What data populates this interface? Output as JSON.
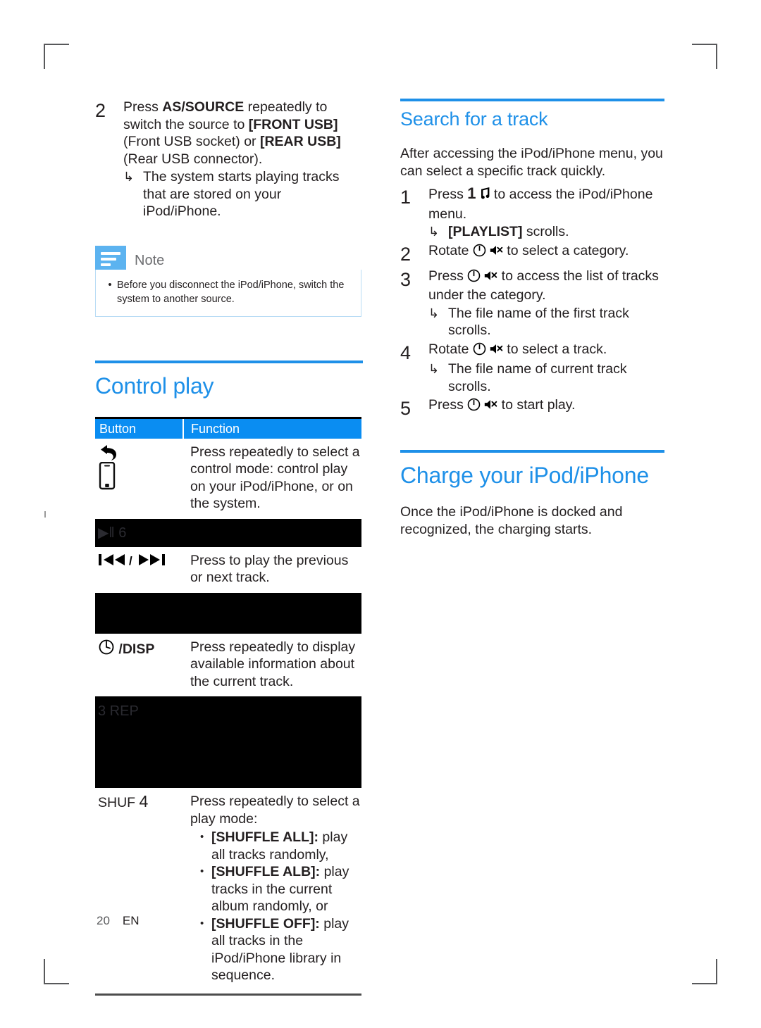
{
  "colors": {
    "brand_blue": "#1e90e8",
    "table_header_blue": "#0a8df2",
    "note_icon_blue": "#5cb3f0",
    "note_border_blue": "#b9dcf5",
    "text_black": "#231f20",
    "redaction_black": "#000000"
  },
  "left_column": {
    "step2": {
      "number": "2",
      "line1_pre": "Press ",
      "line1_bold": "AS/SOURCE",
      "line1_post": " repeatedly to switch the source to ",
      "bold2": "[FRONT USB]",
      "mid": " (Front USB socket) or ",
      "bold3": "[REAR USB]",
      "tail": " (Rear USB connector).",
      "result_arrow": "↳",
      "result": "The system starts playing tracks that are stored on your iPod/iPhone."
    },
    "note": {
      "icon": "note-lines-icon",
      "title": "Note",
      "bullet": "•",
      "text": "Before you disconnect the iPod/iPhone, switch the system to another source."
    },
    "control_play": {
      "title": "Control play",
      "table": {
        "headers": [
          "Button",
          "Function"
        ],
        "rows": [
          {
            "type": "content",
            "button_icons": [
              "back-arrow-icon",
              "iphone-icon"
            ],
            "button_label": "",
            "function": "Press repeatedly to select a control mode: control play on your iPod/iPhone, or on the system."
          },
          {
            "type": "redacted",
            "watermark": "▶ǁ 6",
            "height": "short"
          },
          {
            "type": "content",
            "button_label": "◀◀ / ▶▶",
            "function": "Press to play the previous or next track."
          },
          {
            "type": "redacted",
            "watermark": "",
            "height": "medium"
          },
          {
            "type": "content",
            "button_icon": "clock-power-icon",
            "button_label": "/DISP",
            "function": "Press repeatedly to display available information about the current track."
          },
          {
            "type": "redacted",
            "watermark": "3 REP",
            "height": "tall"
          },
          {
            "type": "content",
            "button_label_plain": "SHUF",
            "button_label_num": "4",
            "function": "Press repeatedly to select a play mode:",
            "bullets": [
              {
                "bold": "[SHUFFLE ALL]:",
                "text": " play all tracks randomly,"
              },
              {
                "bold": "[SHUFFLE ALB]:",
                "text": " play tracks in the current album randomly, or"
              },
              {
                "bold": "[SHUFFLE OFF]:",
                "text": " play all tracks in the iPod/iPhone library in sequence."
              }
            ]
          }
        ]
      }
    }
  },
  "right_column": {
    "search_track": {
      "title": "Search for a track",
      "intro": "After accessing the iPod/iPhone menu, you can select a specific track quickly.",
      "steps": [
        {
          "number": "1",
          "pre": "Press ",
          "key": "1",
          "icon": "music-note-icon",
          "post": " to access the iPod/iPhone menu.",
          "result_arrow": "↳",
          "result_bold": "[PLAYLIST]",
          "result_text": " scrolls."
        },
        {
          "number": "2",
          "pre": "Rotate ",
          "icons": [
            "power-circle-icon",
            "mute-speaker-icon"
          ],
          "post": " to select a category."
        },
        {
          "number": "3",
          "pre": "Press ",
          "icons": [
            "power-circle-icon",
            "mute-speaker-icon"
          ],
          "post": " to access the list of tracks under the category.",
          "result_arrow": "↳",
          "result_text": "The file name of the first track scrolls."
        },
        {
          "number": "4",
          "pre": "Rotate ",
          "icons": [
            "power-circle-icon",
            "mute-speaker-icon"
          ],
          "post": " to select a track.",
          "result_arrow": "↳",
          "result_text": "The file name of current track scrolls."
        },
        {
          "number": "5",
          "pre": "Press ",
          "icons": [
            "power-circle-icon",
            "mute-speaker-icon"
          ],
          "post": " to start play."
        }
      ]
    },
    "charge": {
      "title": "Charge your iPod/iPhone",
      "para": "Once the iPod/iPhone is docked and recognized, the charging starts."
    }
  },
  "footer": {
    "page_number": "20",
    "language": "EN"
  }
}
